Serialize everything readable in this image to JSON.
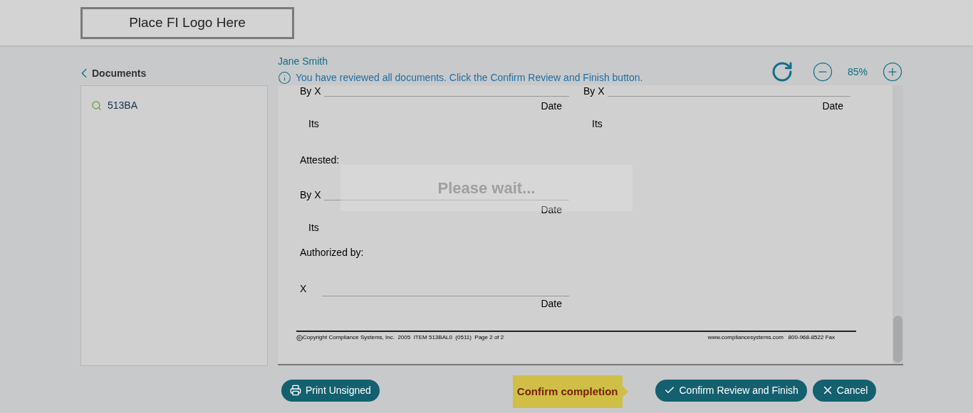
{
  "header": {
    "logo_text": "Place FI Logo Here"
  },
  "sidebar": {
    "back_label": "Documents",
    "items": [
      {
        "label": "513BA",
        "selected": false
      }
    ]
  },
  "viewer": {
    "user_name": "Jane Smith",
    "notice": "You have reviewed all documents. Click the Confirm Review and Finish button.",
    "zoom": "85%"
  },
  "document": {
    "top_blocks": [
      {
        "by": "By X",
        "date": "Date",
        "its": "Its"
      },
      {
        "by": "By X",
        "date": "Date",
        "its": "Its"
      }
    ],
    "attested_label": "Attested:",
    "attested_block": {
      "by": "By X",
      "date": "Date",
      "its": "Its"
    },
    "authorized_label": "Authorized by:",
    "authorized_block": {
      "by": "X",
      "date": "Date"
    },
    "footer_left": "Copyright Compliance Systems, Inc.  2005  ITEM 513BAL0  (0511)  Page 2 of 2",
    "footer_right": "www.compliancesystems.com   800-968-8522 Fax"
  },
  "overlay": {
    "text": "Please wait..."
  },
  "actions": {
    "print": "Print Unsigned",
    "tooltip": "Confirm completion",
    "confirm": "Confirm Review and Finish",
    "cancel": "Cancel"
  }
}
